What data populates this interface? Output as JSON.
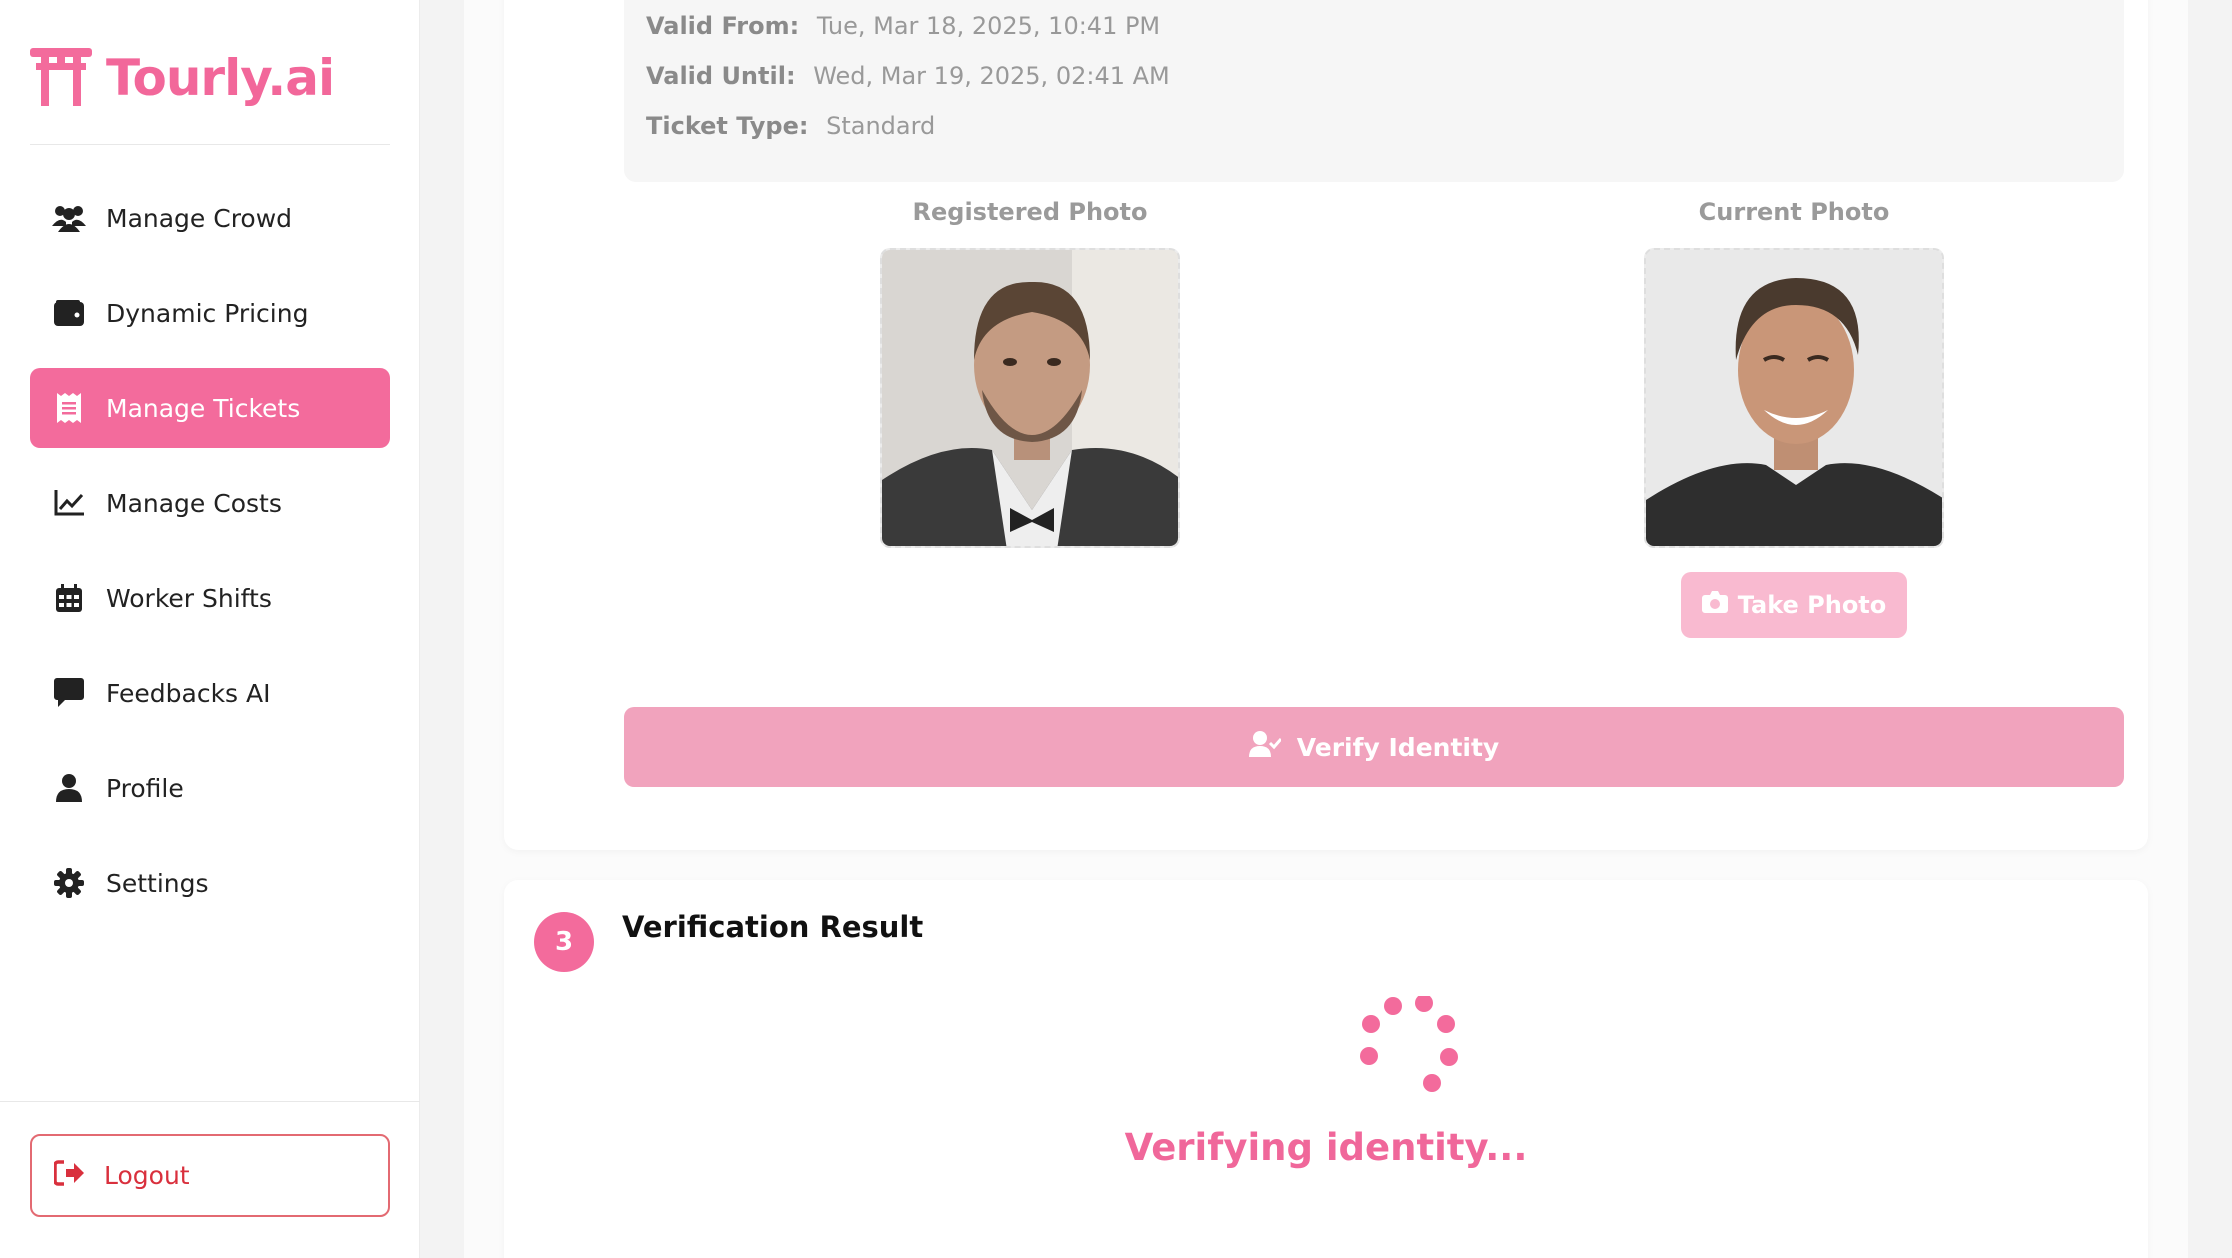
{
  "brand": {
    "name": "Tourly.ai",
    "accent": "#f36b9c"
  },
  "sidebar": {
    "items": [
      {
        "label": "Manage Crowd",
        "icon": "users-icon",
        "active": false
      },
      {
        "label": "Dynamic Pricing",
        "icon": "wallet-icon",
        "active": false
      },
      {
        "label": "Manage Tickets",
        "icon": "receipt-icon",
        "active": true
      },
      {
        "label": "Manage Costs",
        "icon": "line-chart-icon",
        "active": false
      },
      {
        "label": "Worker Shifts",
        "icon": "calendar-icon",
        "active": false
      },
      {
        "label": "Feedbacks AI",
        "icon": "comment-icon",
        "active": false
      },
      {
        "label": "Profile",
        "icon": "user-icon",
        "active": false
      },
      {
        "label": "Settings",
        "icon": "gear-icon",
        "active": false
      }
    ],
    "logout_label": "Logout"
  },
  "ticket": {
    "valid_from_label": "Valid From:",
    "valid_from": "Tue, Mar 18, 2025, 10:41 PM",
    "valid_until_label": "Valid Until:",
    "valid_until": "Wed, Mar 19, 2025, 02:41 AM",
    "type_label": "Ticket Type:",
    "type": "Standard"
  },
  "photos": {
    "registered_title": "Registered Photo",
    "current_title": "Current Photo",
    "take_photo_label": "Take Photo"
  },
  "verify_button_label": "Verify Identity",
  "result": {
    "step": "3",
    "title": "Verification Result",
    "status": "Verifying identity..."
  }
}
